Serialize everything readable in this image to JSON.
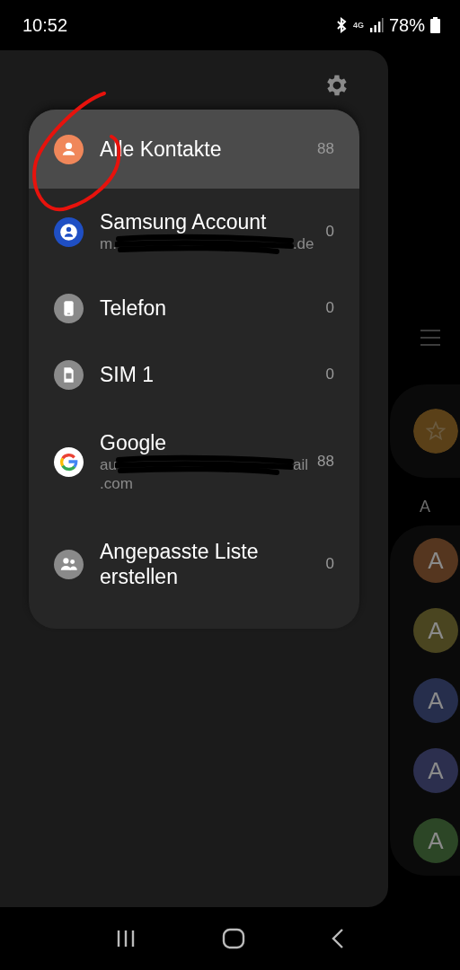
{
  "status_bar": {
    "time": "10:52",
    "network": "4G",
    "battery": "78%"
  },
  "accounts": [
    {
      "kind": "all",
      "label": "Alle Kontakte",
      "count": "88",
      "selected": true
    },
    {
      "kind": "samsung",
      "label": "Samsung Account",
      "detail_start": "m.",
      "detail_end": ".de",
      "count": "0",
      "selected": false
    },
    {
      "kind": "phone",
      "label": "Telefon",
      "count": "0",
      "selected": false
    },
    {
      "kind": "sim",
      "label": "SIM 1",
      "count": "0",
      "selected": false
    },
    {
      "kind": "google",
      "label": "Google",
      "detail_start": "au",
      "detail_end": "ail",
      "detail_line2": ".com",
      "count": "88",
      "selected": false
    },
    {
      "kind": "custom",
      "label": "Angepasste Liste erstellen",
      "count": "0",
      "selected": false
    }
  ],
  "background_list": {
    "favorite": {
      "color": "#5a4018"
    },
    "section": "A",
    "contacts": [
      {
        "initial": "A",
        "color": "#55361f"
      },
      {
        "initial": "A",
        "color": "#4a4520"
      },
      {
        "initial": "A",
        "color": "#262e4c"
      },
      {
        "initial": "A",
        "color": "#2c2f4e"
      },
      {
        "initial": "A",
        "color": "#2c4626"
      }
    ]
  }
}
